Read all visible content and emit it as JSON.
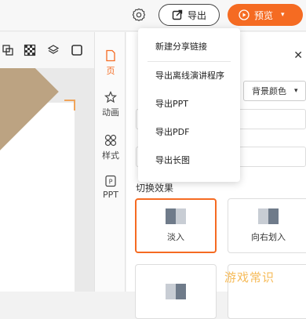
{
  "toolbar": {
    "export_label": "导出",
    "preview_label": "预览"
  },
  "side_tabs": [
    {
      "label": "页",
      "icon": "page-icon"
    },
    {
      "label": "动画",
      "icon": "animation-icon"
    },
    {
      "label": "样式",
      "icon": "style-icon"
    },
    {
      "label": "PPT",
      "icon": "ppt-icon"
    }
  ],
  "panel": {
    "background_color_label": "背景颜色",
    "transition_title": "切换效果",
    "transitions": [
      {
        "label": "淡入",
        "selected": true
      },
      {
        "label": "向右划入",
        "selected": false
      },
      {
        "label": "",
        "selected": false
      },
      {
        "label": "",
        "selected": false
      }
    ]
  },
  "export_menu": {
    "items": [
      "新建分享链接",
      "导出离线演讲程序",
      "导出PPT",
      "导出PDF",
      "导出长图"
    ]
  },
  "watermark": "游戏常识",
  "colors": {
    "accent": "#f56b22",
    "canvas_shape": "#bca382"
  }
}
